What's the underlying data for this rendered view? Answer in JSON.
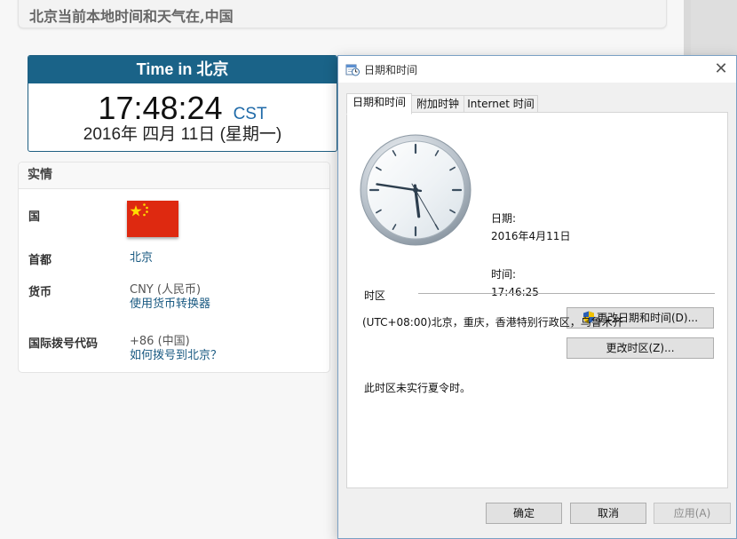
{
  "webpage": {
    "heading": "北京当前本地时间和天气在,中国",
    "time_box": {
      "title": "Time in 北京",
      "time": "17:48:24",
      "tz": "CST",
      "date": "2016年 四月 11日 (星期一)"
    },
    "facts": {
      "title": "实情",
      "country_label": "国",
      "capital_label": "首都",
      "capital_value": "北京",
      "currency_label": "货币",
      "currency_value": "CNY (人民币)",
      "currency_link": "使用货币转换器",
      "dial_label": "国际拨号代码",
      "dial_value": "+86 (中国)",
      "dial_link": "如何拨号到北京？"
    }
  },
  "dialog": {
    "title": "日期和时间",
    "close_glyph": "✕",
    "tabs": [
      "日期和时间",
      "附加时钟",
      "Internet 时间"
    ],
    "date_label": "日期:",
    "date_value": "2016年4月11日",
    "time_label": "时间:",
    "time_value": "17:46:25",
    "change_datetime_button": "更改日期和时间(D)...",
    "timezone_section": "时区",
    "timezone_value": "(UTC+08:00)北京，重庆，香港特别行政区，乌鲁木齐",
    "change_timezone_button": "更改时区(Z)...",
    "dst_note": "此时区未实行夏令时。",
    "ok_button": "确定",
    "cancel_button": "取消",
    "apply_button": "应用(A)",
    "clock": {
      "hours": 17,
      "minutes": 46,
      "seconds": 25
    }
  },
  "colors": {
    "time_box_header": "#1a6388",
    "link": "#1a5a82",
    "flag_red": "#de2910",
    "flag_star": "#ffde00"
  },
  "icons": [
    "datetime-app-icon",
    "close-icon",
    "uac-shield-icon",
    "china-flag-icon"
  ]
}
